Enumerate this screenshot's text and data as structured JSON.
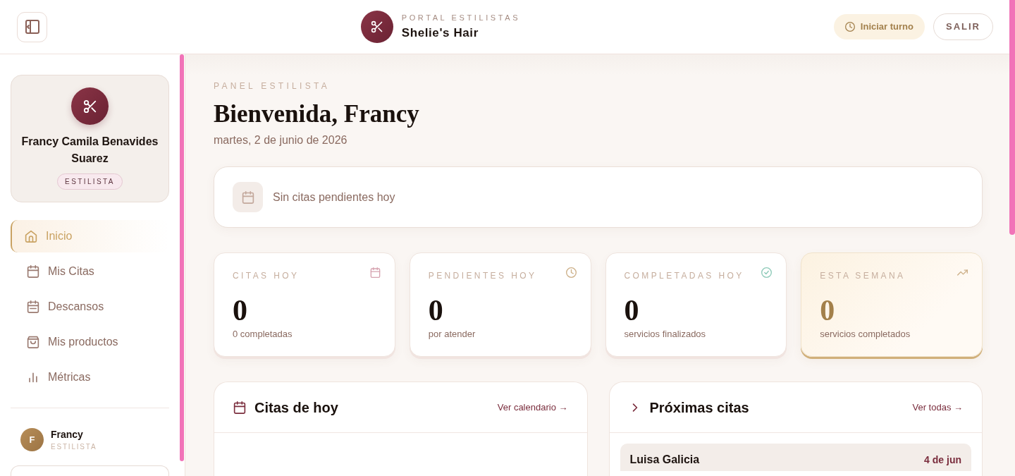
{
  "topbar": {
    "brand": {
      "subtitle": "PORTAL ESTILISTAS",
      "title": "Shelie's Hair"
    },
    "shift_button": "Iniciar turno",
    "logout_button": "SALIR"
  },
  "sidebar": {
    "profile": {
      "name": "Francy Camila Benavides Suarez",
      "role": "ESTILISTA"
    },
    "items": [
      {
        "label": "Inicio",
        "selected": true
      },
      {
        "label": "Mis Citas",
        "selected": false
      },
      {
        "label": "Descansos",
        "selected": false
      },
      {
        "label": "Mis productos",
        "selected": false
      },
      {
        "label": "Métricas",
        "selected": false
      }
    ],
    "user": {
      "initial": "F",
      "name": "Francy",
      "role": "ESTILISTA"
    }
  },
  "header": {
    "eyebrow": "PANEL ESTILISTA",
    "title": "Bienvenida, Francy",
    "date": "martes, 2 de junio de 2026"
  },
  "notice": {
    "text": "Sin citas pendientes hoy"
  },
  "stats": [
    {
      "label": "CITAS HOY",
      "value": "0",
      "caption": "0 completadas",
      "highlighted": false
    },
    {
      "label": "PENDIENTES HOY",
      "value": "0",
      "caption": "por atender",
      "highlighted": false
    },
    {
      "label": "COMPLETADAS HOY",
      "value": "0",
      "caption": "servicios finalizados",
      "highlighted": false
    },
    {
      "label": "ESTA SEMANA",
      "value": "0",
      "caption": "servicios completados",
      "highlighted": true
    }
  ],
  "panels": [
    {
      "title": "Citas de hoy",
      "link": "Ver calendario →"
    },
    {
      "title": "Próximas citas",
      "link": "Ver todas →",
      "rows": [
        {
          "name": "Luisa Galicia",
          "date": "4 de jun"
        }
      ]
    }
  ]
}
